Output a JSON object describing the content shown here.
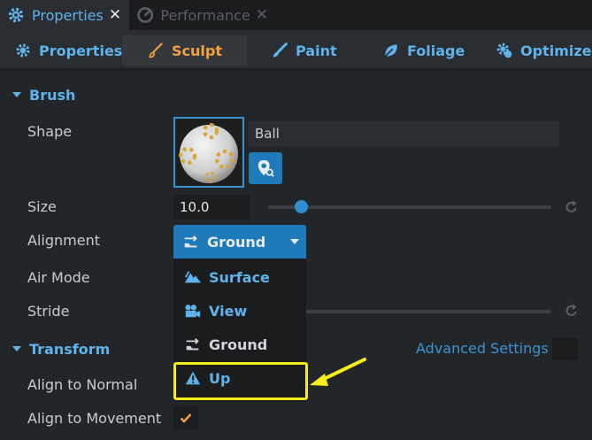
{
  "tabs": [
    {
      "label": "Properties",
      "icon": "gear-icon",
      "active": true
    },
    {
      "label": "Performance",
      "icon": "speedometer-icon",
      "active": false
    }
  ],
  "tools": [
    {
      "label": "Properties",
      "icon": "gear-icon"
    },
    {
      "label": "Sculpt",
      "icon": "brush-icon",
      "selected": true
    },
    {
      "label": "Paint",
      "icon": "paint-brush-icon"
    },
    {
      "label": "Foliage",
      "icon": "leaf-icon"
    },
    {
      "label": "Optimize",
      "icon": "gear-check-icon"
    }
  ],
  "brush": {
    "header": "Brush",
    "shape_label": "Shape",
    "shape_value": "Ball",
    "size_label": "Size",
    "size_value": "10.0",
    "size_fraction": 0.12,
    "alignment_label": "Alignment",
    "alignment_value": "Ground",
    "air_mode_label": "Air Mode",
    "stride_label": "Stride"
  },
  "alignment_menu": [
    {
      "label": "Surface",
      "icon": "mountain-icon"
    },
    {
      "label": "View",
      "icon": "camera-icon"
    },
    {
      "label": "Ground",
      "icon": "ground-arrow-icon"
    },
    {
      "label": "Up",
      "icon": "up-warning-icon"
    }
  ],
  "transform": {
    "header": "Transform",
    "advanced_label": "Advanced Settings",
    "align_normal_label": "Align to Normal",
    "align_movement_label": "Align to Movement",
    "align_movement_checked": true
  },
  "colors": {
    "accent": "#5fb3ea",
    "selected_tool": "#f2a03d",
    "highlight": "#f6ee1a",
    "button": "#1e7ab8"
  }
}
